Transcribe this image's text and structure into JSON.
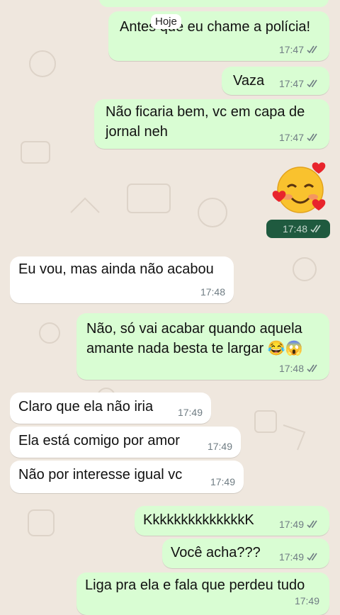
{
  "date_chip": "Hoje",
  "messages": [
    {
      "id": "m0",
      "dir": "out",
      "text": "Antes que eu chame a polícia!",
      "time": "17:47"
    },
    {
      "id": "m1",
      "dir": "out",
      "text": "Vaza",
      "time": "17:47"
    },
    {
      "id": "m2",
      "dir": "out",
      "lines": [
        "Não ficaria bem, vc em capa de",
        "jornal neh"
      ],
      "time": "17:47"
    },
    {
      "id": "m3",
      "dir": "out",
      "emoji": "smiling-face-with-hearts",
      "time": "17:48"
    },
    {
      "id": "m4",
      "dir": "in",
      "text": "Eu vou, mas ainda não acabou",
      "time": "17:48"
    },
    {
      "id": "m5",
      "dir": "out",
      "lines": [
        "Não, só vai acabar quando aquela",
        "amante nada besta te largar 😂😱"
      ],
      "time": "17:48"
    },
    {
      "id": "m6",
      "dir": "in",
      "text": "Claro que ela não iria",
      "time": "17:49"
    },
    {
      "id": "m7",
      "dir": "in",
      "text": "Ela está comigo por amor",
      "time": "17:49"
    },
    {
      "id": "m8",
      "dir": "in",
      "text": "Não por interesse igual vc",
      "time": "17:49"
    },
    {
      "id": "m9",
      "dir": "out",
      "text": "KkkkkkkkkkkkkkK",
      "time": "17:49"
    },
    {
      "id": "m10",
      "dir": "out",
      "text": "Você acha???",
      "time": "17:49"
    },
    {
      "id": "m11",
      "dir": "out",
      "text": "Liga pra ela e fala que perdeu tudo",
      "time": "17:49"
    }
  ],
  "colors": {
    "background": "#efe7de",
    "outgoing_bubble": "#d9fdd3",
    "incoming_bubble": "#ffffff",
    "read_ticks": "#6f7c83",
    "emoji_chip": "#1f5a3f"
  }
}
